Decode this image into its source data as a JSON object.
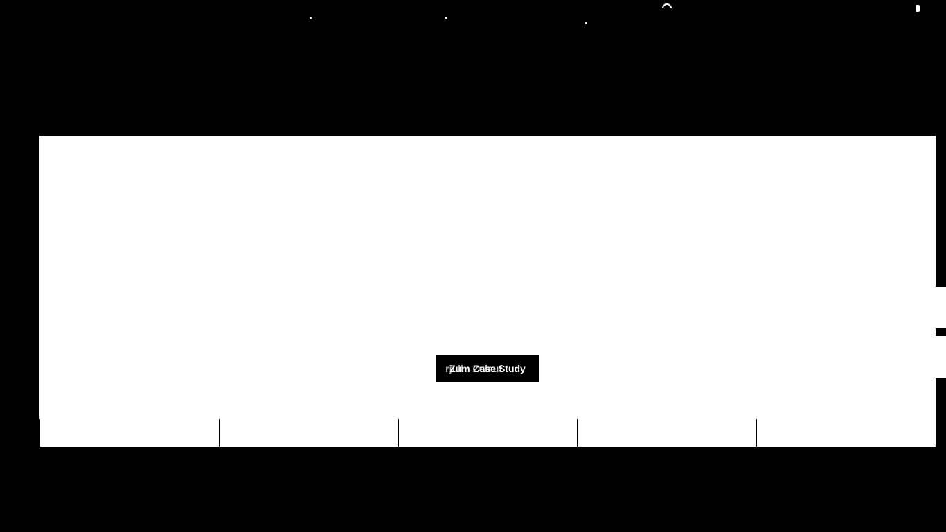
{
  "header": {
    "search_icon": "search-icon",
    "menu_icon": "more-vertical-icon"
  },
  "hero": {
    "title_line1": "",
    "title_line2": "",
    "cta_labels": [
      "Zum Case Study",
      "Zulauf",
      "rjull"
    ],
    "cta_label": "Zum Case Study"
  },
  "side_tabs": [
    {
      "label": ""
    },
    {
      "label": ""
    }
  ],
  "strip": {
    "items": [
      {
        "label": ""
      },
      {
        "label": ""
      },
      {
        "label": ""
      },
      {
        "label": ""
      },
      {
        "label": ""
      }
    ]
  },
  "colors": {
    "background": "#000000",
    "card": "#ffffff",
    "cta_bg": "#000000",
    "cta_text": "#ffffff"
  }
}
